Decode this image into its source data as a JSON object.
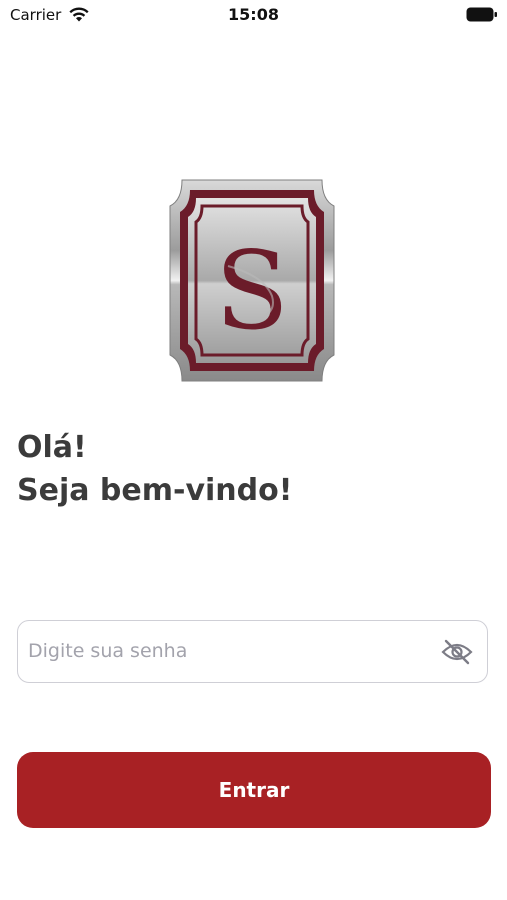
{
  "status_bar": {
    "carrier": "Carrier",
    "time": "15:08",
    "wifi_icon": "wifi-icon",
    "battery_icon": "battery-icon"
  },
  "logo": {
    "icon": "shield-s-logo",
    "letter": "S"
  },
  "greeting": {
    "line1": "Olá!",
    "line2": "Seja bem-vindo!"
  },
  "password": {
    "placeholder": "Digite sua senha",
    "value": "",
    "toggle_icon": "eye-off-icon"
  },
  "login_button": {
    "label": "Entrar"
  },
  "colors": {
    "brand": "#a82124",
    "logo_frame": "#6b1c2a",
    "text": "#3b3b3b",
    "placeholder": "#a3a3ac",
    "field_border": "#cfcfd6"
  }
}
